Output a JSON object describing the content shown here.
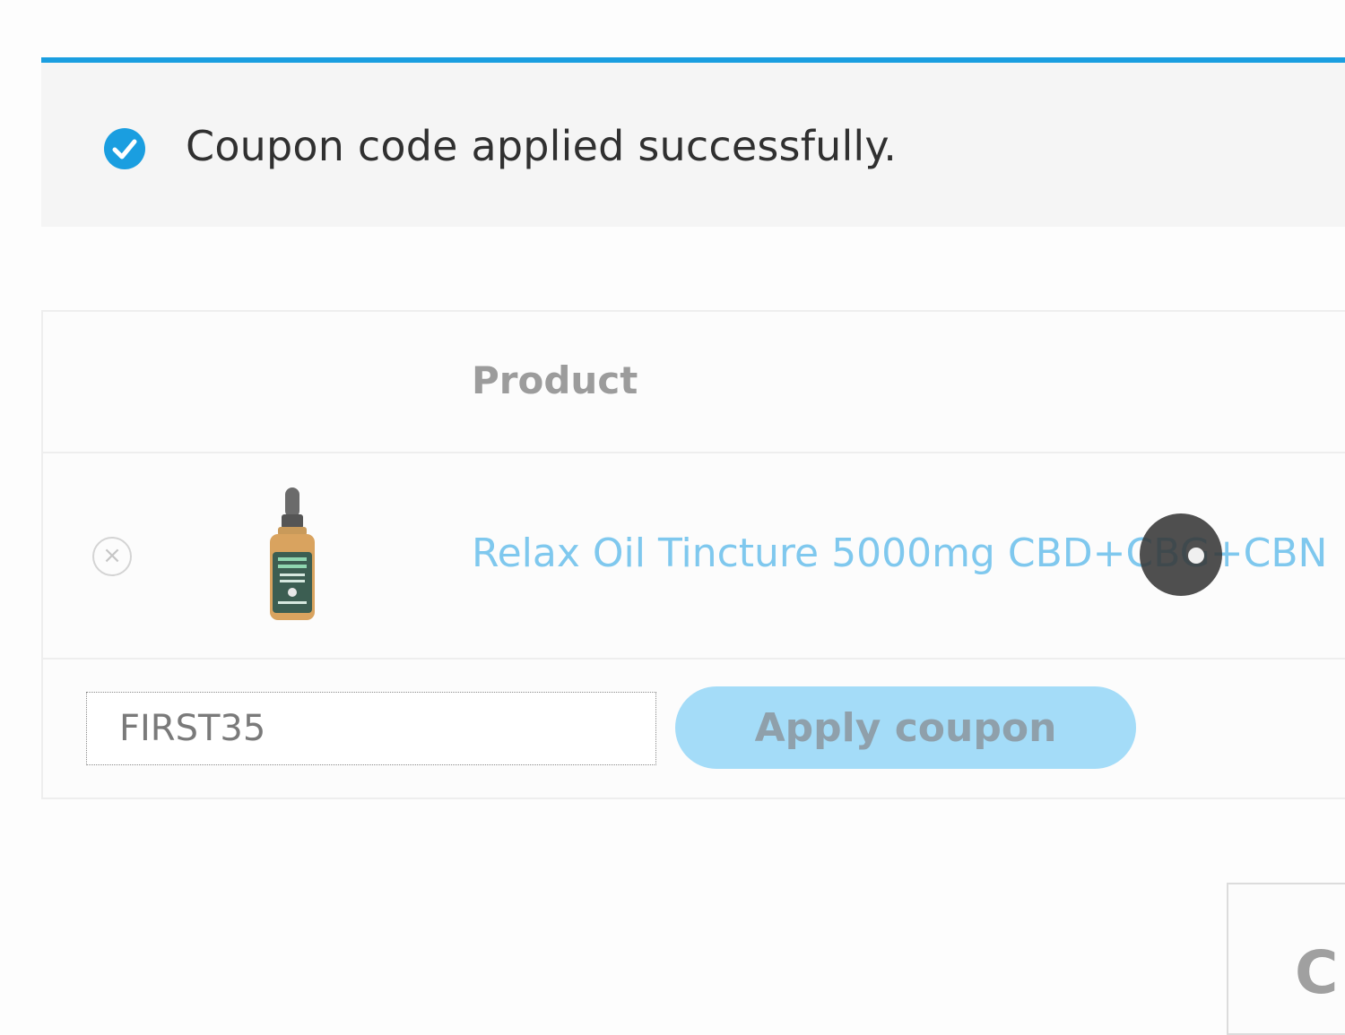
{
  "notice": {
    "message": "Coupon code applied successfully.",
    "icon": "check-circle-icon",
    "accent_color": "#1a9ee0"
  },
  "cart_table": {
    "header": {
      "product": "Product"
    },
    "items": [
      {
        "product_name": "Relax Oil Tincture 5000mg CBD+CBG+CBN",
        "remove_icon": "close-circle-icon",
        "thumbnail_icon": "tincture-bottle-icon"
      }
    ],
    "coupon": {
      "code_value": "FIRST35",
      "apply_label": "Apply coupon"
    }
  },
  "totals": {
    "heading": "C"
  }
}
